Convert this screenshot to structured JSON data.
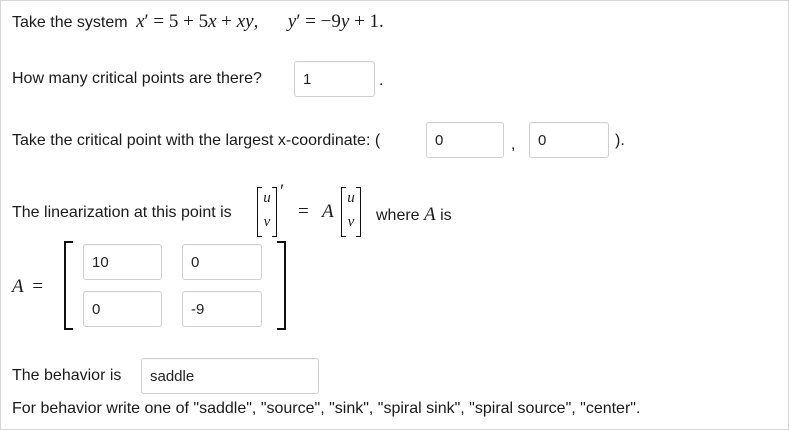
{
  "system": {
    "prefix": "Take the system",
    "eq1_lhs_var": "x",
    "eq1_rhs_a": "= 5 + 5",
    "eq1_rhs_b": "x",
    "eq1_rhs_c": " + ",
    "eq1_rhs_d": "xy",
    "eq1_end": ",",
    "eq2_lhs_var": "y",
    "eq2_rhs_a": "= −9",
    "eq2_rhs_b": "y",
    "eq2_rhs_c": " + 1.",
    "prime": "′"
  },
  "q1": {
    "label": "How many critical points are there?",
    "answer": "1",
    "after": "."
  },
  "q2": {
    "label": "Take the critical point with the largest x-coordinate: (",
    "x_answer": "0",
    "comma": ",",
    "y_answer": "0",
    "close": ")."
  },
  "linearization": {
    "label": "The linearization at this point is",
    "u": "u",
    "v": "v",
    "prime": "′",
    "equals": "=",
    "A": "A",
    "where": "where",
    "is": "is"
  },
  "matrix": {
    "label": "A",
    "equals": "=",
    "rows": [
      [
        "10",
        "0"
      ],
      [
        "0",
        "-9"
      ]
    ]
  },
  "behavior": {
    "label": "The behavior is",
    "answer": "saddle",
    "note": "For behavior write one of \"saddle\", \"source\", \"sink\", \"spiral sink\", \"spiral source\", \"center\"."
  }
}
